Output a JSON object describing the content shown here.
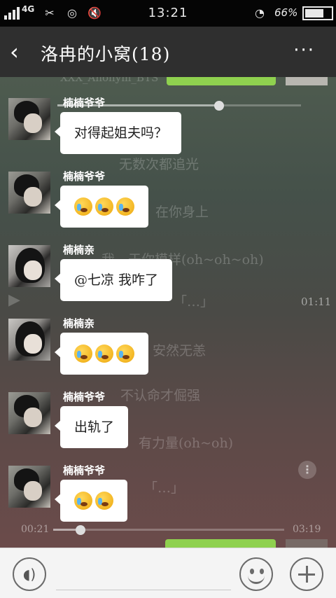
{
  "status_bar": {
    "network": "4G",
    "time": "13:21",
    "battery": "66%"
  },
  "header": {
    "back_icon": "chevron-left-icon",
    "title": "洛冉的小窝(18)",
    "more_label": "···"
  },
  "background_overlay": {
    "line1": "XXX_Anonym_BTS",
    "line2": "无数次都追光",
    "line3": "在你身上",
    "line4": "我…于你模样(oh~oh~oh)",
    "line5": "「…」",
    "time_current_top": "01:11",
    "line6": "安然无恙",
    "line7": "不认命才倔强",
    "line8": "有力量(oh~oh)",
    "line9": "「…」",
    "time_elapsed": "00:21",
    "time_total": "03:19"
  },
  "messages": [
    {
      "sender": "楠楠爷爷",
      "avatar": "boy",
      "type": "text",
      "text": "对得起姐夫吗？"
    },
    {
      "sender": "楠楠爷爷",
      "avatar": "boy",
      "type": "emoji",
      "count": 3,
      "emoji_name": "crying-face-emoji"
    },
    {
      "sender": "楠楠亲",
      "avatar": "girl",
      "type": "text",
      "text": "@七凉  我咋了"
    },
    {
      "sender": "楠楠亲",
      "avatar": "girl",
      "type": "emoji",
      "count": 3,
      "emoji_name": "crying-face-emoji"
    },
    {
      "sender": "楠楠爷爷",
      "avatar": "boy",
      "type": "text",
      "text": "出轨了"
    },
    {
      "sender": "楠楠爷爷",
      "avatar": "boy",
      "type": "emoji",
      "count": 2,
      "emoji_name": "crying-face-emoji"
    }
  ],
  "input_bar": {
    "voice_icon": "voice-icon",
    "input_value": "",
    "emoji_icon": "smiley-icon",
    "plus_icon": "plus-icon"
  },
  "colors": {
    "accent_green": "#8fd14f",
    "header_bg": "#2f2f2f",
    "bubble_bg": "#ffffff"
  }
}
